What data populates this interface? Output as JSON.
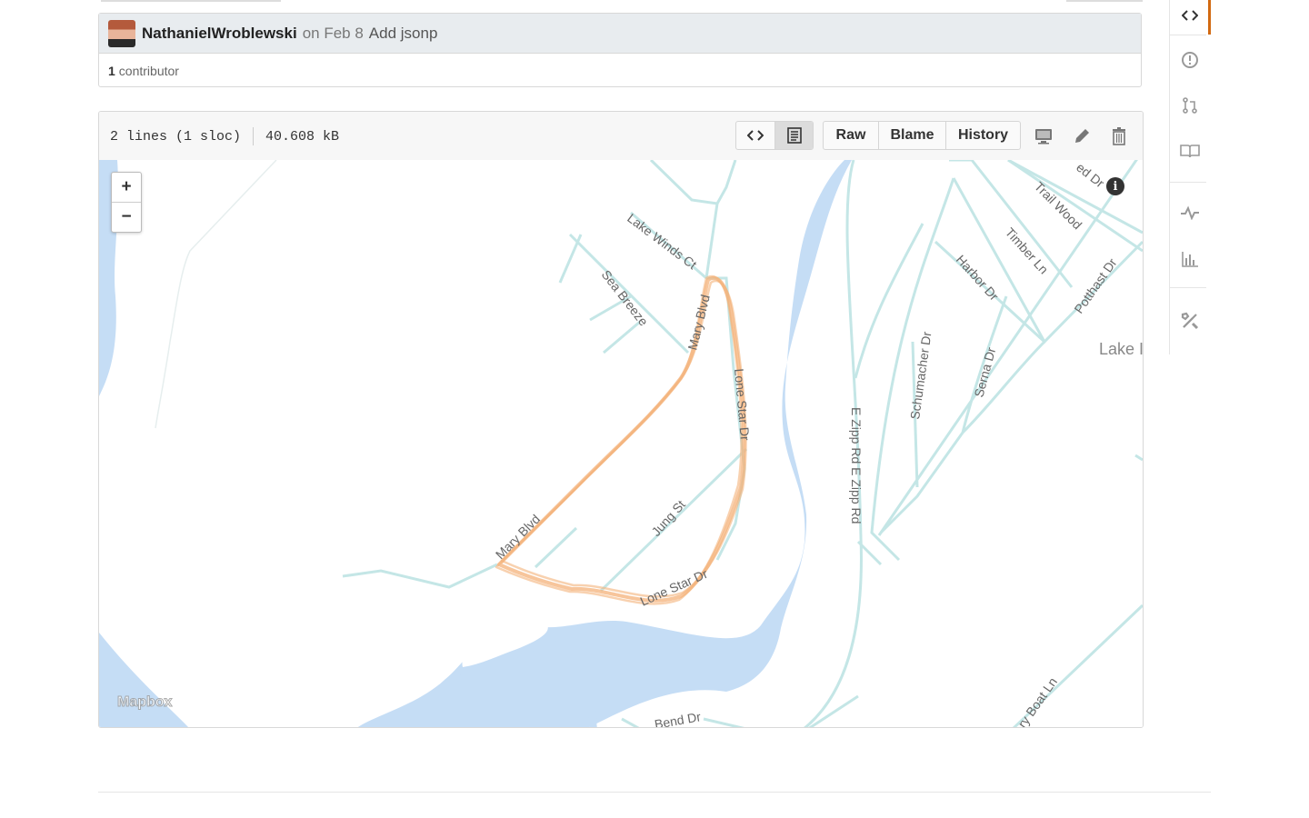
{
  "commit": {
    "author": "NathanielWroblewski",
    "date": "on Feb 8",
    "message": "Add jsonp",
    "contributor_count": "1",
    "contributor_label": "contributor"
  },
  "file": {
    "lines": "2 lines (1 sloc)",
    "size": "40.608 kB",
    "buttons": {
      "raw": "Raw",
      "blame": "Blame",
      "history": "History"
    }
  },
  "map": {
    "zoom_in": "+",
    "zoom_out": "−",
    "info": "i",
    "attribution": "Mapbox",
    "water_color": "#c5ddf5",
    "road_color": "#c4e6e6",
    "track_color": "#f4b27a",
    "labels": {
      "lake_winds": "Lake Winds Ct",
      "sea_breeze": "Sea Breeze",
      "mary_blvd_1": "Mary Blvd",
      "mary_blvd_2": "Mary Blvd",
      "lone_star_1": "Lone Star Dr",
      "lone_star_2": "Lone Star Dr",
      "lone_star_3": "Lone Star Dr",
      "jung": "Jung St",
      "bend": "Bend Dr",
      "zipp": "E Zipp Rd E Zipp Rd",
      "schumacher": "Schumacher Dr",
      "serna": "Serna Dr",
      "harbor": "Harbor Dr",
      "timber": "Timber Ln",
      "trail_wood": "Trail Wood",
      "potthast": "Potthast Dr",
      "ed_dr": "ed Dr",
      "lake": "Lake I",
      "boat": "ry Boat Ln"
    }
  },
  "sidebar": [
    "code-icon",
    "issue-icon",
    "pull-request-icon",
    "wiki-icon",
    "pulse-icon",
    "graph-icon",
    "settings-icon"
  ]
}
